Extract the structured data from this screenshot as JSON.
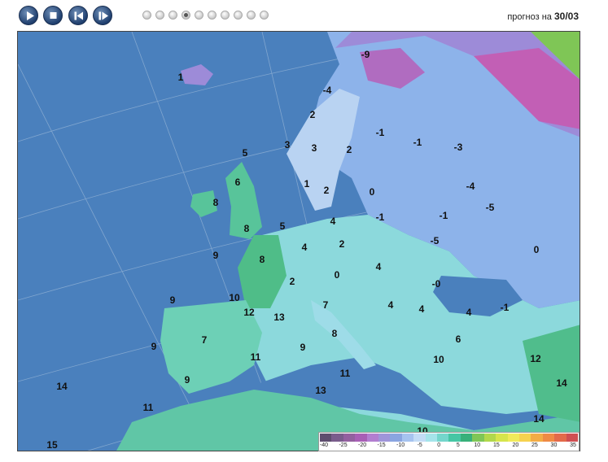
{
  "player": {
    "buttons": [
      {
        "name": "play-button",
        "icon": "play-icon"
      },
      {
        "name": "stop-button",
        "icon": "stop-icon"
      },
      {
        "name": "step-back-button",
        "icon": "step-back-icon"
      },
      {
        "name": "step-forward-button",
        "icon": "step-forward-icon"
      }
    ],
    "frames_total": 10,
    "active_frame": 4
  },
  "forecast": {
    "label": "прогноз на",
    "date": "30/03"
  },
  "map": {
    "temperatures": [
      "1",
      "-9",
      "-4",
      "2",
      "5",
      "3",
      "3",
      "2",
      "-1",
      "-1",
      "-3",
      "6",
      "1",
      "2",
      "0",
      "8",
      "-4",
      "-5",
      "4",
      "-1",
      "-1",
      "8",
      "5",
      "2",
      "-5",
      "4",
      "9",
      "8",
      "0",
      "4",
      "0",
      "2",
      "-0",
      "9",
      "10",
      "12",
      "7",
      "4",
      "4",
      "-1",
      "13",
      "8",
      "4",
      "7",
      "6",
      "9",
      "11",
      "12",
      "9",
      "10",
      "14",
      "9",
      "11",
      "14",
      "13",
      "11",
      "14",
      "10",
      "15"
    ]
  },
  "legend": {
    "ticks": [
      "-40",
      "-25",
      "-20",
      "-15",
      "-10",
      "-5",
      "0",
      "5",
      "10",
      "15",
      "20",
      "25",
      "30",
      "35"
    ],
    "colors": [
      "#5e4e6e",
      "#7a5c8c",
      "#93609f",
      "#a85fb5",
      "#b27ed0",
      "#9f95d9",
      "#8aa5e0",
      "#a6c3ef",
      "#c3dcf6",
      "#a5e4ea",
      "#74d6cc",
      "#46c6a4",
      "#38b07a",
      "#7fc656",
      "#b1d84c",
      "#d6e54c",
      "#f0ea5a",
      "#f6d24f",
      "#f3ac46",
      "#ef8a45",
      "#e36a4a",
      "#cf4f52"
    ],
    "accent_sea": "#4a80bd"
  }
}
